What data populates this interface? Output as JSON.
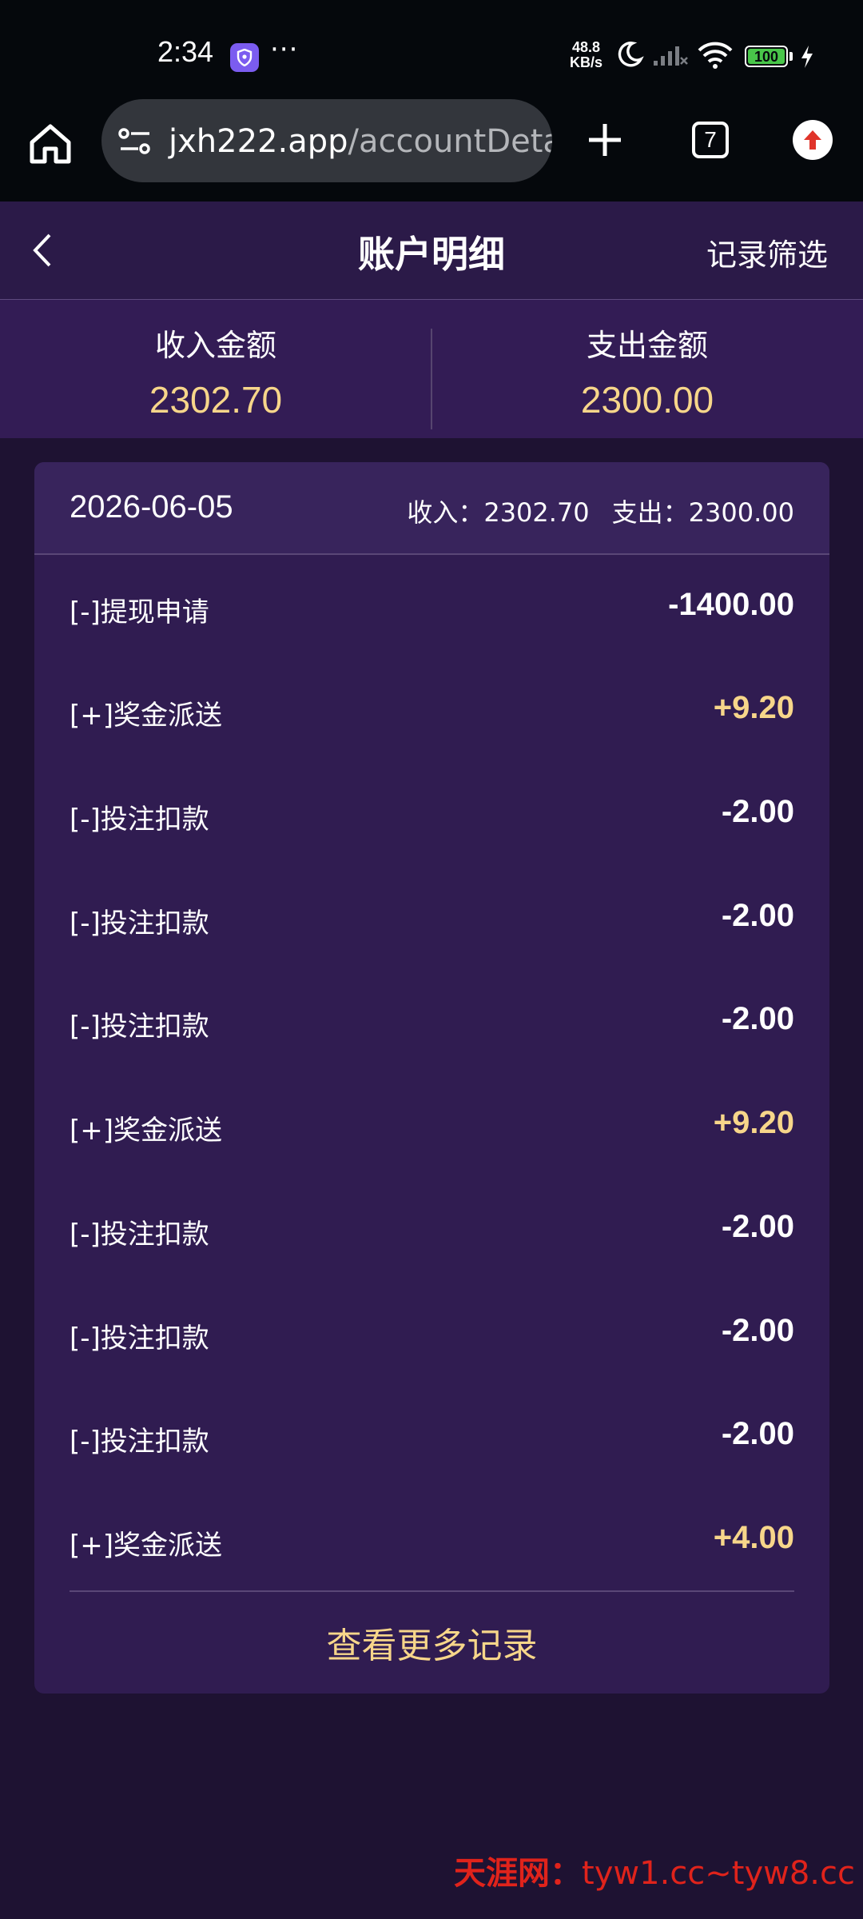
{
  "status_bar": {
    "time": "2:34",
    "net_speed_value": "48.8",
    "net_speed_unit": "KB/s",
    "battery": "100",
    "icons": [
      "app-shield-icon",
      "more-dots-icon",
      "moon-icon",
      "signal-icon",
      "wifi-icon",
      "battery-icon",
      "charging-icon"
    ]
  },
  "browser": {
    "url_host": "jxh222.app",
    "url_path": "/accountDeta",
    "tab_count": "7"
  },
  "header": {
    "title": "账户明细",
    "filter_label": "记录筛选"
  },
  "summary": {
    "income_label": "收入金额",
    "income_value": "2302.70",
    "expense_label": "支出金额",
    "expense_value": "2300.00"
  },
  "day_group": {
    "date": "2026-06-05",
    "income_label": "收入：",
    "income_value": "2302.70",
    "expense_label": "支出：",
    "expense_value": "2300.00"
  },
  "records": [
    {
      "label": "[-]提现申请",
      "amount": "-1400.00",
      "type": "neg"
    },
    {
      "label": "[+]奖金派送",
      "amount": "+9.20",
      "type": "pos"
    },
    {
      "label": "[-]投注扣款",
      "amount": "-2.00",
      "type": "neg"
    },
    {
      "label": "[-]投注扣款",
      "amount": "-2.00",
      "type": "neg"
    },
    {
      "label": "[-]投注扣款",
      "amount": "-2.00",
      "type": "neg"
    },
    {
      "label": "[+]奖金派送",
      "amount": "+9.20",
      "type": "pos"
    },
    {
      "label": "[-]投注扣款",
      "amount": "-2.00",
      "type": "neg"
    },
    {
      "label": "[-]投注扣款",
      "amount": "-2.00",
      "type": "neg"
    },
    {
      "label": "[-]投注扣款",
      "amount": "-2.00",
      "type": "neg"
    },
    {
      "label": "[+]奖金派送",
      "amount": "+4.00",
      "type": "pos"
    }
  ],
  "more_records_label": "查看更多记录",
  "watermark": {
    "brand": "天涯网：",
    "domains": "tyw1.cc~tyw8.cc"
  },
  "colors": {
    "page_bg": "#1e1232",
    "header_bg": "#2b1a48",
    "card_bg": "#301c51",
    "accent_gold": "#f7d68a",
    "watermark_red": "#e0231b"
  }
}
